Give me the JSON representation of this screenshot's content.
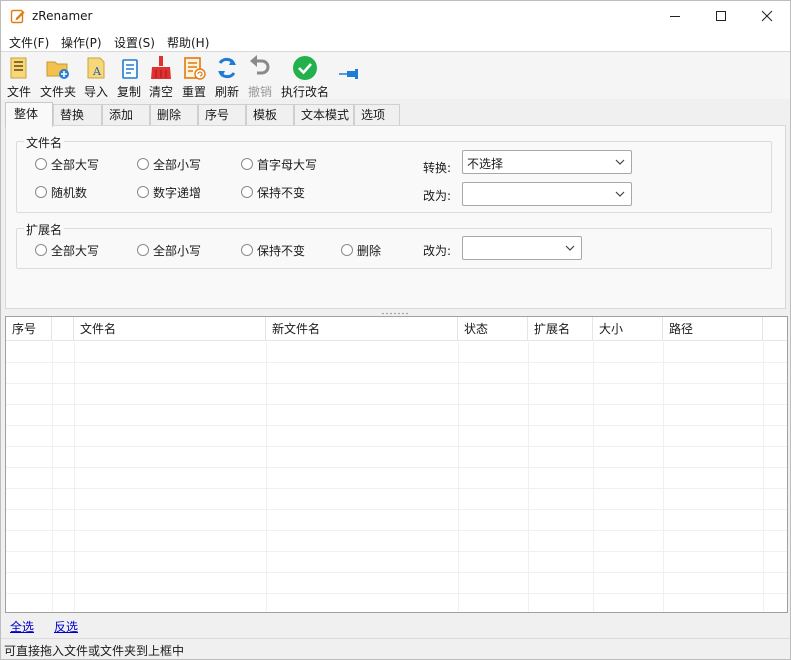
{
  "window": {
    "title": "zRenamer"
  },
  "menu": {
    "items": [
      "文件(F)",
      "操作(P)",
      "设置(S)",
      "帮助(H)"
    ]
  },
  "toolbar": {
    "items": [
      {
        "label": "文件",
        "icon": "add-file-icon"
      },
      {
        "label": "文件夹",
        "icon": "add-folder-icon"
      },
      {
        "label": "导入",
        "icon": "import-icon"
      },
      {
        "label": "复制",
        "icon": "copy-icon"
      },
      {
        "label": "清空",
        "icon": "broom-icon"
      },
      {
        "label": "重置",
        "icon": "reset-icon"
      },
      {
        "label": "刷新",
        "icon": "refresh-icon"
      },
      {
        "label": "撤销",
        "icon": "undo-icon",
        "disabled": true
      },
      {
        "label": "执行改名",
        "icon": "check-circle-icon"
      }
    ],
    "pin_icon": "pin-icon"
  },
  "tabs": {
    "items": [
      "整体",
      "替换",
      "添加",
      "删除",
      "序号",
      "模板",
      "文本模式",
      "选项"
    ],
    "active": "整体"
  },
  "filename_group": {
    "title": "文件名",
    "radios": [
      "全部大写",
      "全部小写",
      "首字母大写",
      "随机数",
      "数字递增",
      "保持不变"
    ],
    "convert_label": "转换:",
    "convert_value": "不选择",
    "change_label": "改为:",
    "change_value": ""
  },
  "extension_group": {
    "title": "扩展名",
    "radios": [
      "全部大写",
      "全部小写",
      "保持不变",
      "删除"
    ],
    "change_label": "改为:",
    "change_value": ""
  },
  "list": {
    "columns": [
      "序号",
      "",
      "文件名",
      "新文件名",
      "状态",
      "扩展名",
      "大小",
      "路径"
    ]
  },
  "links": {
    "select_all": "全选",
    "invert": "反选"
  },
  "status": {
    "text": "可直接拖入文件或文件夹到上框中"
  },
  "colors": {
    "accent_blue": "#1e7bd6",
    "check_green": "#22b14c",
    "broom_red": "#e03030",
    "folder_yellow": "#f2c14e"
  }
}
